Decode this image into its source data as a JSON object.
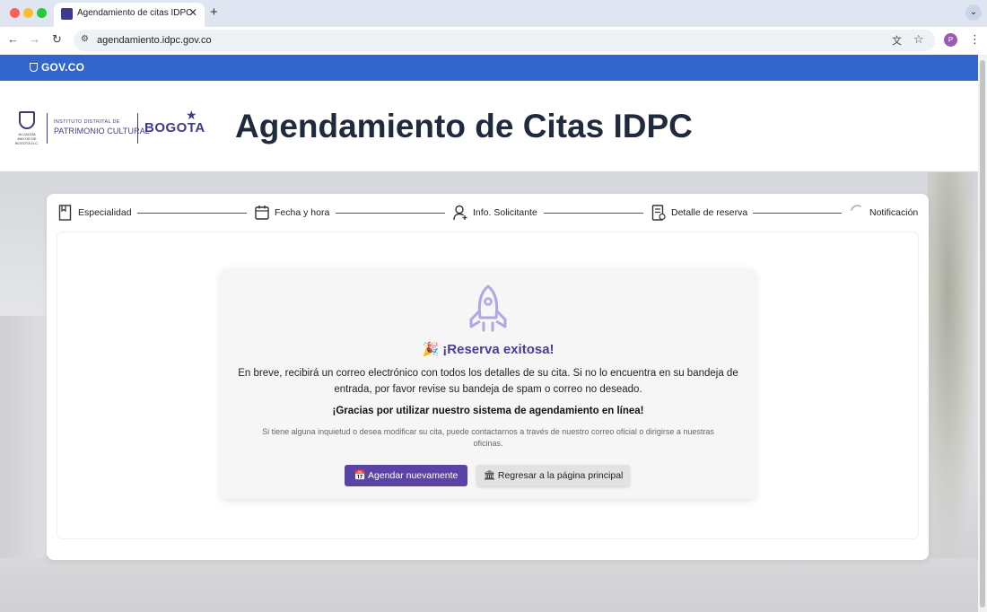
{
  "browser": {
    "tab_title": "Agendamiento de citas IDPC",
    "tab_close": "✕",
    "new_tab": "+",
    "tab_menu": "⌄",
    "url": "agendamiento.idpc.gov.co",
    "profile_initial": "P",
    "nav_back": "←",
    "nav_forward": "→",
    "nav_reload": "↻",
    "kebab": "⋮"
  },
  "gov_bar": {
    "logo_text": "GOV.CO"
  },
  "header": {
    "crest_text": "ALCALDÍA MAYOR DE BOGOTÁ D.C.",
    "idpc_small": "INSTITUTO DISTRITAL DE",
    "idpc_big": "PATRIMONIO CULTURAL",
    "bogota": "BOGOTA",
    "title": "Agendamiento de Citas IDPC"
  },
  "stepper": {
    "steps": [
      {
        "label": "Especialidad",
        "icon": "bookmark-icon"
      },
      {
        "label": "Fecha y hora",
        "icon": "calendar-icon"
      },
      {
        "label": "Info. Solicitante",
        "icon": "user-add-icon"
      },
      {
        "label": "Detalle de reserva",
        "icon": "receipt-icon"
      },
      {
        "label": "Notificación",
        "icon": "spinner-icon"
      }
    ]
  },
  "result": {
    "icon": "rocket-icon",
    "title": "🎉 ¡Reserva exitosa!",
    "message": "En breve, recibirá un correo electrónico con todos los detalles de su cita. Si no lo encuentra en su bandeja de entrada, por favor revise su bandeja de spam o correo no deseado.",
    "thanks": "¡Gracias por utilizar nuestro sistema de agendamiento en línea!",
    "help": "Si tiene alguna inquietud o desea modificar su cita, puede contactarnos a través de nuestro correo oficial o dirigirse a nuestras oficinas.",
    "primary_button": "📅 Agendar nuevamente",
    "secondary_button": "🏛 Regresar a la página principal"
  },
  "colors": {
    "gov_blue": "#3366cc",
    "primary": "#5a43a4",
    "title_purple": "#4a3d9a",
    "stepper_line": "#4b4fa8"
  }
}
